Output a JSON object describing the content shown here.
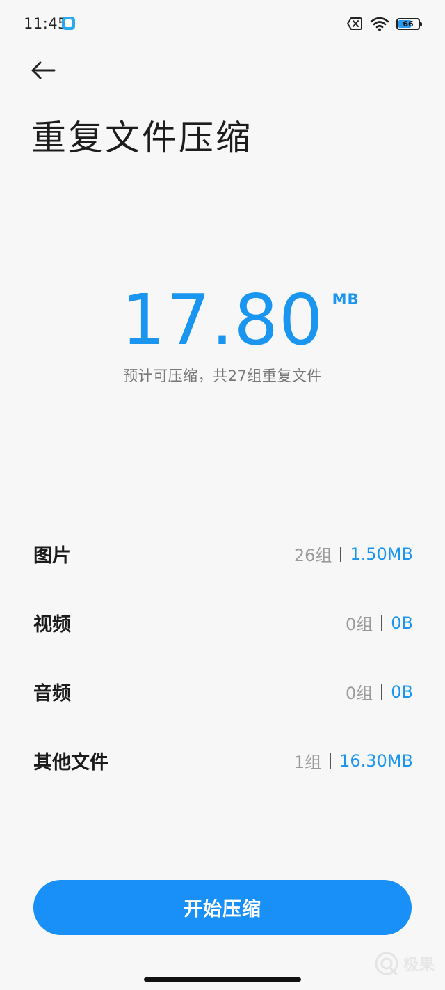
{
  "status_bar": {
    "time": "11:45",
    "battery_level": 66,
    "battery_label": "66",
    "icons": [
      "app-notification-icon",
      "sim-disabled-icon",
      "wifi-icon",
      "battery-icon"
    ]
  },
  "header": {
    "back_icon": "arrow-left-icon",
    "title": "重复文件压缩"
  },
  "summary": {
    "amount": "17.80",
    "unit": "MB",
    "caption": "预计可压缩，共27组重复文件"
  },
  "categories": [
    {
      "name": "图片",
      "count": "26组",
      "size": "1.50MB"
    },
    {
      "name": "视频",
      "count": "0组",
      "size": "0B"
    },
    {
      "name": "音频",
      "count": "0组",
      "size": "0B"
    },
    {
      "name": "其他文件",
      "count": "1组",
      "size": "16.30MB"
    }
  ],
  "actions": {
    "start_label": "开始压缩"
  },
  "watermark": {
    "text": "极果"
  },
  "colors": {
    "accent": "#1a96f0",
    "button": "#1890f8",
    "background": "#f7f7f7",
    "muted_text": "#9a9a9a"
  }
}
